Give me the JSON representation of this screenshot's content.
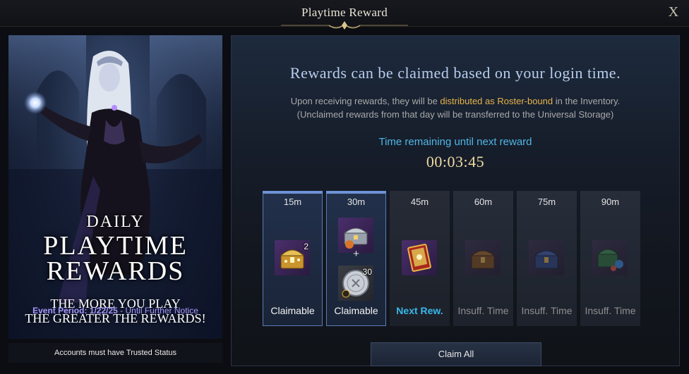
{
  "window": {
    "title": "Playtime Reward",
    "close_label": "X"
  },
  "banner": {
    "daily": "DAILY",
    "title_line1": "PLAYTIME",
    "title_line2": "REWARDS",
    "subtitle_line1": "THE MORE YOU PLAY",
    "subtitle_line2": "THE GREATER THE REWARDS!",
    "event_label": "Event Period: 1/22/25",
    "event_rest": " - Until Further Notice",
    "trusted": "Accounts must have Trusted Status"
  },
  "panel": {
    "headline": "Rewards can be claimed based on your login time.",
    "info_pre": "Upon receiving rewards, they will be ",
    "info_highlight": "distributed as Roster-bound",
    "info_post": " in the Inventory.",
    "info_line2": "(Unclaimed rewards from that day will be transferred to the Universal Storage)",
    "timer_label": "Time remaining until next reward",
    "timer": "00:03:45",
    "claim_all": "Claim All"
  },
  "slots": [
    {
      "time": "15m",
      "status": "Claimable",
      "state": "claimable",
      "items": [
        {
          "icon": "gold-chest-icon",
          "qty": "2"
        }
      ]
    },
    {
      "time": "30m",
      "status": "Claimable",
      "state": "claimable",
      "items": [
        {
          "icon": "silver-chest-icon",
          "qty": ""
        },
        {
          "icon": "silver-coin-icon",
          "qty": "30"
        }
      ],
      "plus": "+"
    },
    {
      "time": "45m",
      "status": "Next Rew.",
      "state": "next",
      "items": [
        {
          "icon": "card-pack-icon",
          "qty": ""
        }
      ]
    },
    {
      "time": "60m",
      "status": "Insuff. Time",
      "state": "insuff",
      "items": [
        {
          "icon": "bronze-chest-icon",
          "qty": ""
        }
      ]
    },
    {
      "time": "75m",
      "status": "Insuff. Time",
      "state": "insuff",
      "items": [
        {
          "icon": "blue-chest-icon",
          "qty": ""
        }
      ]
    },
    {
      "time": "90m",
      "status": "Insuff. Time",
      "state": "insuff",
      "items": [
        {
          "icon": "gem-chest-icon",
          "qty": ""
        }
      ]
    }
  ],
  "colors": {
    "accent_blue": "#4fb6e4",
    "highlight_gold": "#e7b34a",
    "timer_gold": "#f0dca2",
    "event_purple": "#a898ff"
  }
}
